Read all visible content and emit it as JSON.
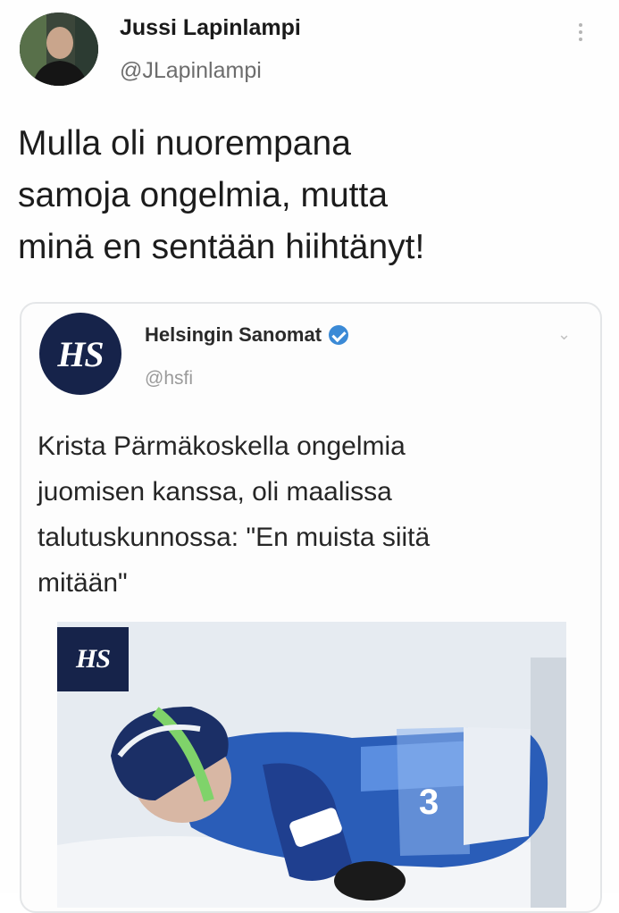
{
  "tweet": {
    "author_name": "Jussi Lapinlampi",
    "author_handle": "@JLapinlampi",
    "text_lines": [
      "Mulla oli nuorempana",
      "samoja ongelmia, mutta",
      "minä en sentään hiihtänyt!"
    ]
  },
  "quoted_tweet": {
    "logo_text": "HS",
    "author_name": "Helsingin Sanomat",
    "author_handle": "@hsfi",
    "text_lines": [
      "Krista Pärmäkoskella ongelmia",
      "juomisen kanssa, oli maalissa",
      "talutuskunnossa: \"En muista siitä",
      "mitään\""
    ],
    "photo_badge": "HS",
    "bib_number": "3"
  },
  "icons": {
    "menu": "kebab-menu-icon",
    "verified": "verified-badge-icon",
    "chevron": "chevron-down-icon"
  },
  "colors": {
    "hs_navy": "#16234a",
    "verified_blue": "#3b8ad6",
    "handle_gray": "#6d6d6d"
  }
}
